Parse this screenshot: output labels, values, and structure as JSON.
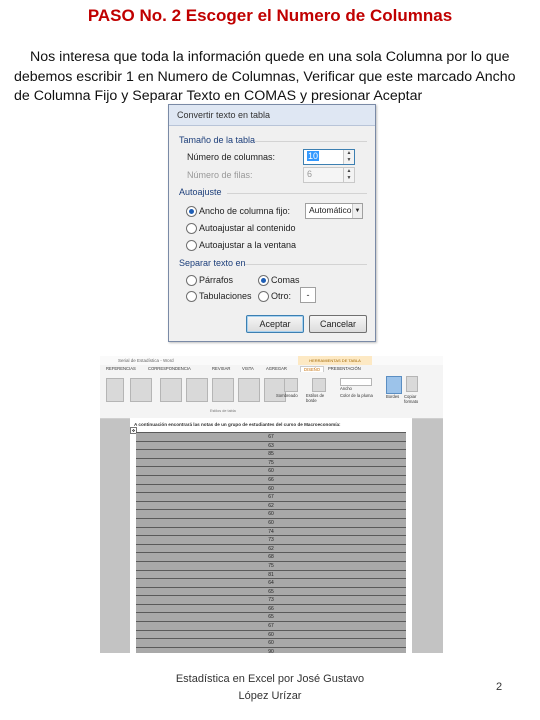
{
  "title": "PASO No. 2 Escoger el Numero de Columnas",
  "paragraph": "Nos interesa que toda la información quede en una sola Columna por lo que debemos escribir 1 en Numero de Columnas, Verificar que este marcado Ancho de Columna Fijo y Separar Texto en  COMAS y presionar Aceptar",
  "dialog": {
    "title": "Convertir texto en tabla",
    "table_size_group": "Tamaño de la tabla",
    "columns_label": "Número de columnas:",
    "columns_value": "10",
    "rows_label": "Número de filas:",
    "rows_value": "6",
    "autofit_group": "Autoajuste",
    "fixed_width_label": "Ancho de columna fijo:",
    "fixed_width_value": "Automático",
    "autofit_content_label": "Autoajustar al contenido",
    "autofit_window_label": "Autoajustar a la ventana",
    "separate_group": "Separar texto en",
    "paragraphs_label": "Párrafos",
    "commas_label": "Comas",
    "tabs_label": "Tabulaciones",
    "other_label": "Otro:",
    "other_value": "-",
    "ok_label": "Aceptar",
    "cancel_label": "Cancelar"
  },
  "word": {
    "window_title": "Serial de Estadística - Word",
    "context_label": "HERRAMIENTAS DE TABLA",
    "tabs": [
      "REFERENCIAS",
      "CORRESPONDENCIA",
      "REVISAR",
      "VISTA",
      "AGREGAR",
      "DISEÑO",
      "PRESENTACIÓN"
    ],
    "ribbon_labels": [
      "Sombreado",
      "Estilos de borde",
      "Bordes",
      "Copiar formato",
      "Ancho",
      "Color de la pluma"
    ],
    "group_label": "Estilos de tabla",
    "doc_heading": "A continuación encontrará las notas de un grupo de estudiantes del curso de Macroeconomía:",
    "grades": [
      "67",
      "63",
      "85",
      "75",
      "60",
      "66",
      "60",
      "67",
      "62",
      "60",
      "60",
      "74",
      "73",
      "62",
      "68",
      "75",
      "81",
      "64",
      "65",
      "73",
      "66",
      "65",
      "67",
      "60",
      "60",
      "90"
    ]
  },
  "footer": {
    "text_line1": "Estadística en Excel por José Gustavo",
    "text_line2": "López Urízar",
    "page_number": "2"
  }
}
